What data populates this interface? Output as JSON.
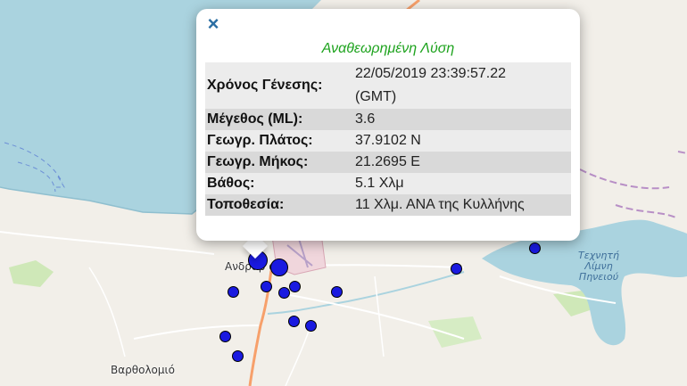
{
  "map": {
    "places": [
      {
        "name": "Ανδραβίδα",
        "visible_text": "Ανδραβ  α"
      },
      {
        "name": "Βαρθολομιό"
      }
    ],
    "lake_label": [
      "Τεχνητή",
      "Λίμνη",
      "Πηνειού"
    ],
    "colors": {
      "sea": "#aad3df",
      "land": "#f2efe9",
      "green": "#cfe8b8",
      "road": "#f7a06b",
      "quake": "#1a1ae0"
    },
    "icons": [
      "quake-marker",
      "close-icon"
    ]
  },
  "popup": {
    "close_symbol": "×",
    "title": "Αναθεωρημένη Λύση",
    "rows": [
      {
        "label": "Χρόνος Γένεσης:",
        "value_line1": "22/05/2019 23:39:57.22",
        "value_line2": "(GMT)"
      },
      {
        "label": "Μέγεθος (ML):",
        "value": "3.6"
      },
      {
        "label": "Γεωγρ. Πλάτος:",
        "value": "37.9102 N"
      },
      {
        "label": "Γεωγρ. Μήκος:",
        "value": "21.2695 E"
      },
      {
        "label": "Βάθος:",
        "value": "5.1 Χλμ"
      },
      {
        "label": "Τοποθεσία:",
        "value": "11 Χλμ. ΑΝΑ της Κυλλήνης"
      }
    ]
  }
}
